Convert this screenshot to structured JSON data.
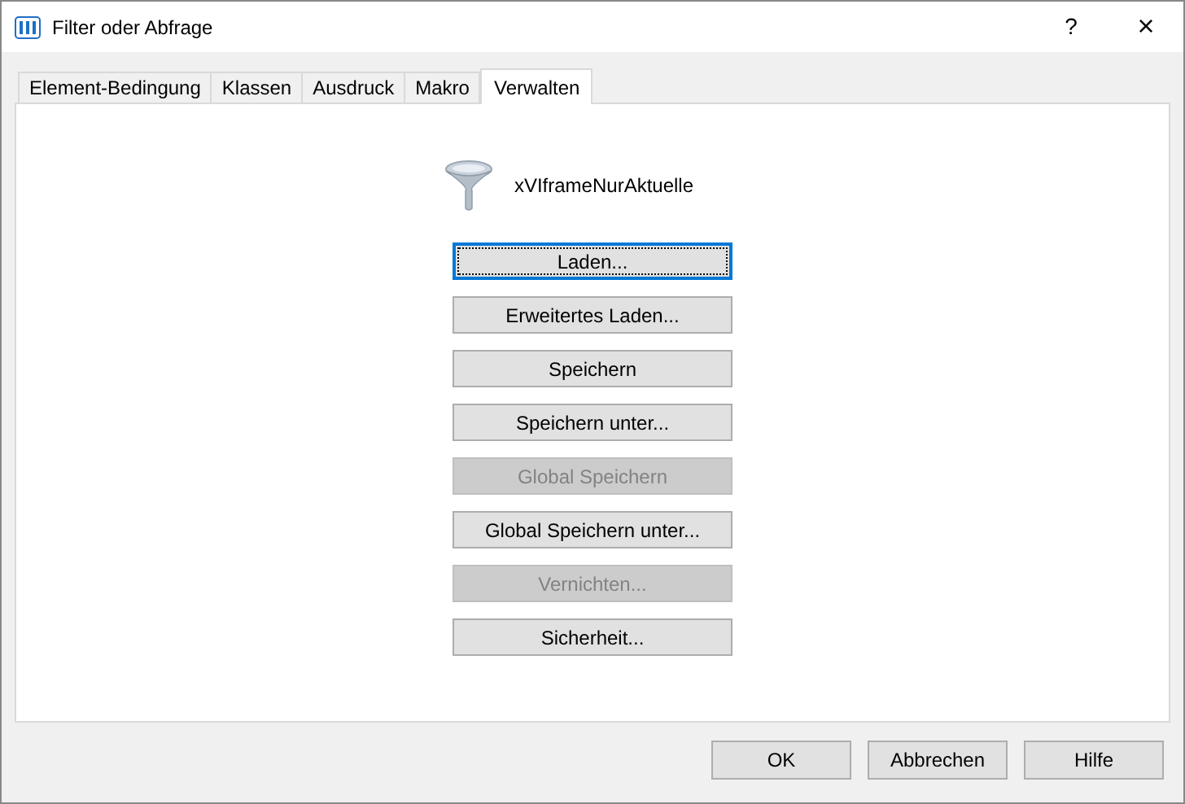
{
  "window": {
    "title": "Filter oder Abfrage",
    "help": "?",
    "close": "×"
  },
  "tabs": [
    {
      "label": "Element-Bedingung",
      "selected": false
    },
    {
      "label": "Klassen",
      "selected": false
    },
    {
      "label": "Ausdruck",
      "selected": false
    },
    {
      "label": "Makro",
      "selected": false
    },
    {
      "label": "Verwalten",
      "selected": true
    }
  ],
  "query_name": "xVIframeNurAktuelle",
  "actions": [
    {
      "label": "Laden...",
      "disabled": false,
      "focused": true
    },
    {
      "label": "Erweitertes Laden...",
      "disabled": false,
      "focused": false
    },
    {
      "label": "Speichern",
      "disabled": false,
      "focused": false
    },
    {
      "label": "Speichern unter...",
      "disabled": false,
      "focused": false
    },
    {
      "label": "Global Speichern",
      "disabled": true,
      "focused": false
    },
    {
      "label": "Global Speichern unter...",
      "disabled": false,
      "focused": false
    },
    {
      "label": "Vernichten...",
      "disabled": true,
      "focused": false
    },
    {
      "label": "Sicherheit...",
      "disabled": false,
      "focused": false
    }
  ],
  "buttons": [
    "OK",
    "Abbrechen",
    "Hilfe"
  ]
}
